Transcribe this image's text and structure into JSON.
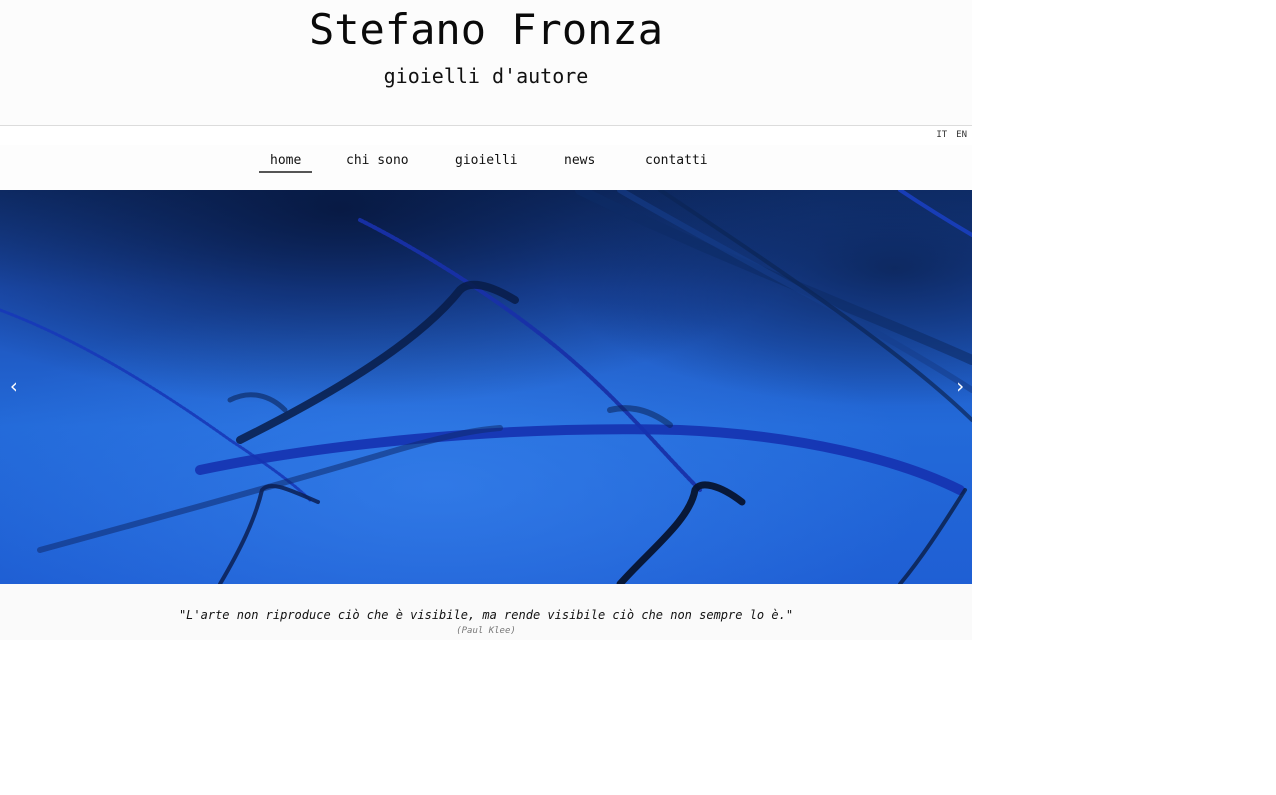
{
  "header": {
    "title": "Stefano Fronza",
    "subtitle": "gioielli d'autore"
  },
  "languages": [
    "IT",
    "EN"
  ],
  "nav": {
    "items": [
      {
        "label": "home",
        "active": true
      },
      {
        "label": "chi sono",
        "active": false
      },
      {
        "label": "gioielli",
        "active": false
      },
      {
        "label": "news",
        "active": false
      },
      {
        "label": "contatti",
        "active": false
      }
    ]
  },
  "slider": {
    "prev_label": "‹",
    "next_label": "›",
    "image_description_colors": [
      "#1f5fd4",
      "#0b2a6b",
      "#2a7ae8"
    ]
  },
  "quote": {
    "text": "\"L'arte non riproduce ciò che è visibile, ma rende visibile ciò che non sempre lo è.\"",
    "author": "(Paul Klee)"
  }
}
